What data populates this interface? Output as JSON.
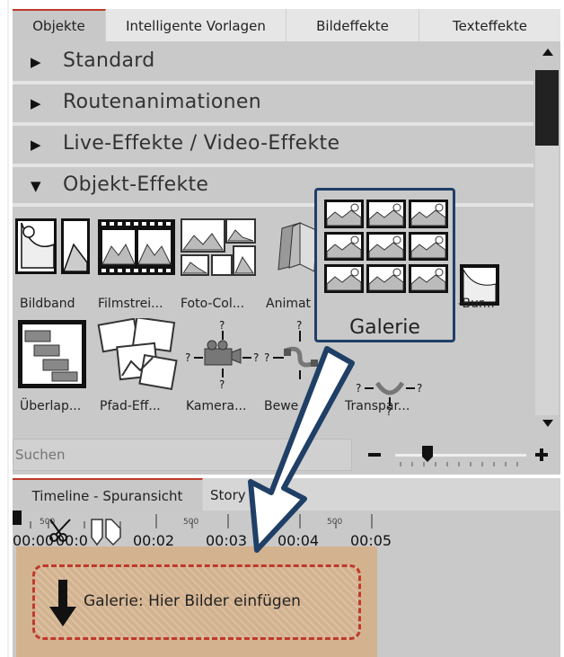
{
  "tabs": [
    "Objekte",
    "Intelligente Vorlagen",
    "Bildeffekte",
    "Texteffekte"
  ],
  "categories": [
    {
      "label": "Standard",
      "expanded": false
    },
    {
      "label": "Routenanimationen",
      "expanded": false
    },
    {
      "label": "Live-Effekte / Video-Effekte",
      "expanded": false
    },
    {
      "label": "Objekt-Effekte",
      "expanded": true
    }
  ],
  "effects_row1": [
    "Bildband",
    "Filmstrei...",
    "Foto-Col...",
    "Animat",
    "-Bur..."
  ],
  "effects_row2": [
    "Überlap...",
    "Pfad-Eff...",
    "Kamera...",
    "Bewe",
    "Transpar..."
  ],
  "search": {
    "placeholder": "Suchen"
  },
  "popup": {
    "label": "Galerie"
  },
  "timeline": {
    "tabs": [
      "Timeline - Spuransicht",
      "Story"
    ],
    "ruler": [
      "00:00",
      "00:0",
      "00:02",
      "00:03",
      "00:04",
      "00:05"
    ],
    "ms_marks": [
      "500",
      "500",
      "500",
      "500"
    ],
    "drop_label": "Galerie: Hier Bilder einfügen"
  },
  "colors": {
    "accent": "#c0392b",
    "popup_border": "#1f3f66",
    "clip": "#d3b28f"
  }
}
